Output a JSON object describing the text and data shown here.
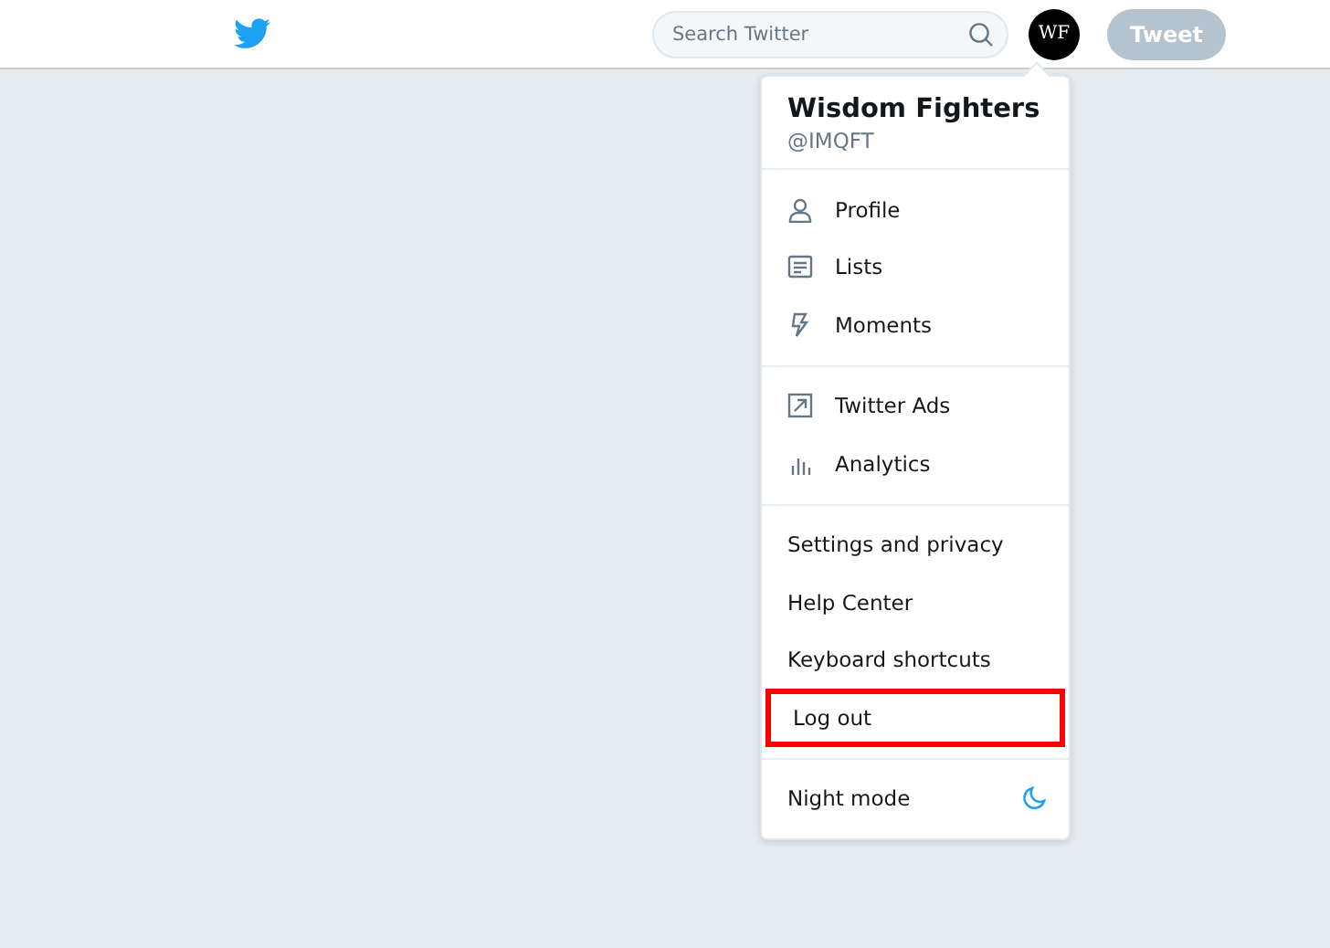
{
  "search": {
    "placeholder": "Search Twitter"
  },
  "avatar": {
    "initials": "WF"
  },
  "tweet_button": {
    "label": "Tweet",
    "disabled": true
  },
  "menu": {
    "name": "Wisdom Fighters",
    "handle": "@IMQFT",
    "sections": [
      {
        "items": [
          {
            "kind": "profile",
            "label": "Profile",
            "highlighted": false
          },
          {
            "kind": "lists",
            "label": "Lists",
            "highlighted": false
          },
          {
            "kind": "moments",
            "label": "Moments",
            "highlighted": false
          }
        ]
      },
      {
        "items": [
          {
            "kind": "ads",
            "label": "Twitter Ads",
            "highlighted": false
          },
          {
            "kind": "analytics",
            "label": "Analytics",
            "highlighted": false
          }
        ]
      },
      {
        "items": [
          {
            "kind": "text",
            "label": "Settings and privacy",
            "highlighted": false
          },
          {
            "kind": "text",
            "label": "Help Center",
            "highlighted": false
          },
          {
            "kind": "text",
            "label": "Keyboard shortcuts",
            "highlighted": false
          },
          {
            "kind": "text",
            "label": "Log out",
            "highlighted": true
          }
        ]
      },
      {
        "items": [
          {
            "kind": "night",
            "label": "Night mode",
            "highlighted": false
          }
        ]
      }
    ]
  }
}
